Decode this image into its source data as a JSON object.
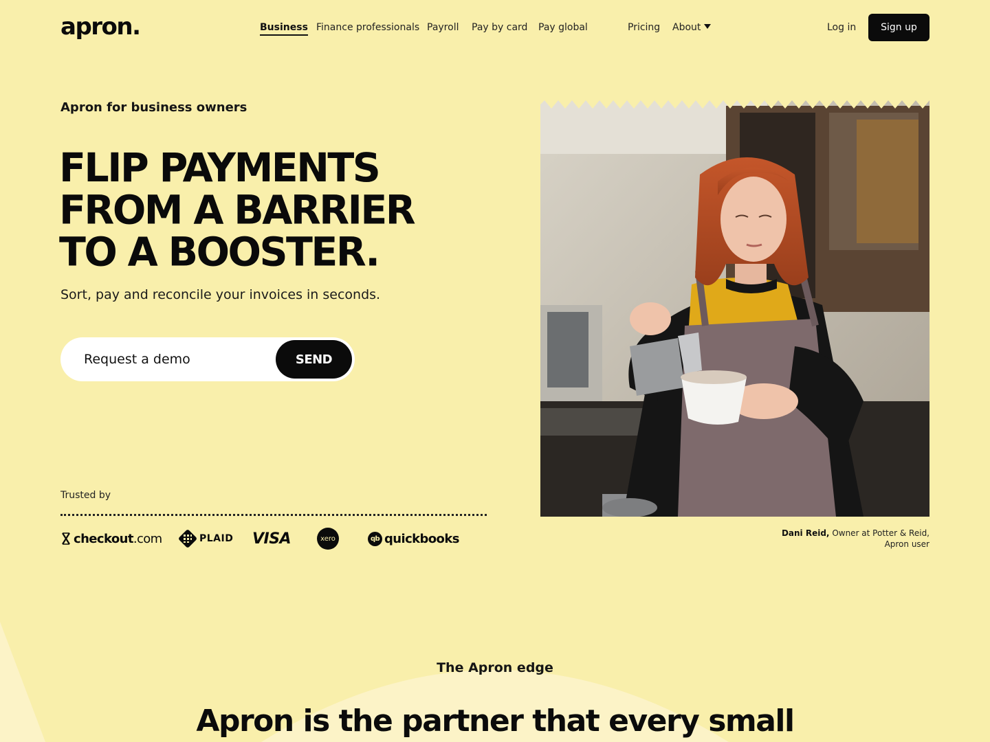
{
  "header": {
    "logo": "apron.",
    "nav": [
      {
        "label": "Business"
      },
      {
        "label": "Finance professionals"
      },
      {
        "label": "Payroll"
      },
      {
        "label": "Pay by card"
      },
      {
        "label": "Pay global"
      },
      {
        "label": "Pricing"
      },
      {
        "label": "About"
      }
    ],
    "login_label": "Log in",
    "signup_label": "Sign up"
  },
  "hero": {
    "eyebrow": "Apron for business owners",
    "headline_lines": [
      "FLIP PAYMENTS",
      "FROM A BARRIER",
      "TO A BOOSTER."
    ],
    "subhead": "Sort, pay and reconcile your invoices in seconds.",
    "demo_placeholder": "Request a demo",
    "send_label": "SEND"
  },
  "trusted": {
    "label": "Trusted by",
    "partners": {
      "checkout_bold": "checkout",
      "checkout_thin": ".com",
      "plaid": "PLAID",
      "visa": "VISA",
      "xero": "xero",
      "qb_mark": "qb",
      "quickbooks": "quickbooks"
    }
  },
  "testimonial": {
    "name": "Dani Reid,",
    "role": " Owner at Potter & Reid,",
    "role_line2": "Apron user"
  },
  "edge_section": {
    "eyebrow": "The Apron edge",
    "title_before": "Apron is the ",
    "title_strong": "partner",
    "title_after": " that every small"
  },
  "colors": {
    "background": "#f9efab",
    "ink": "#0b0b0b",
    "white": "#ffffff"
  }
}
